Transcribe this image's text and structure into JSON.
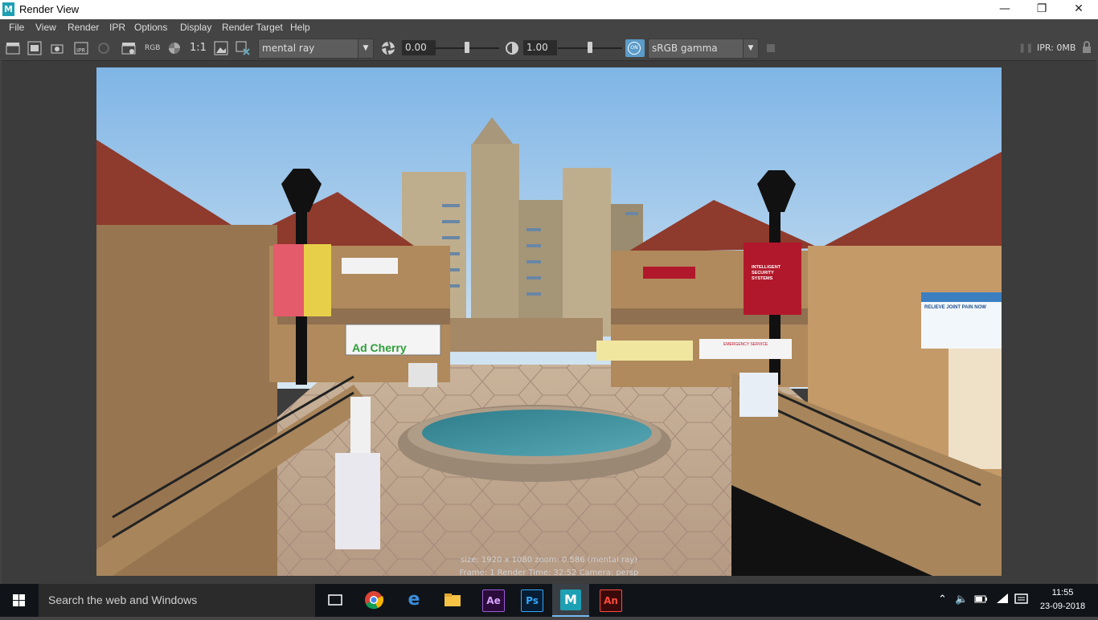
{
  "window": {
    "title": "Render View",
    "app_icon_letter": "M",
    "minimize_icon": "minimize-icon",
    "restore_icon": "restore-icon",
    "close_icon": "close-icon"
  },
  "menu": [
    "File",
    "View",
    "Render",
    "IPR",
    "Options",
    "Display",
    "Render Target",
    "Help"
  ],
  "toolbar": {
    "rgb_label": "RGB",
    "ratio_label": "1:1",
    "renderer": "mental ray",
    "exposure_value": "0.00",
    "exposure_level": 0.5,
    "gamma_value": "1.00",
    "gamma_level": 0.5,
    "colorspace_toggle_label": "ON",
    "colorspace": "sRGB gamma",
    "ipr_memory": "IPR: 0MB"
  },
  "render_info": {
    "line1": "size: 1920 x 1080 zoom: 0.586          (mental ray)",
    "line2": "Frame: 1          Render Time: 32:52          Camera: persp"
  },
  "scene": {
    "sign_cherry": "Ad Cherry",
    "sign_security_1": "INTELLIGENT",
    "sign_security_2": "SECURITY",
    "sign_security_3": "SYSTEMS",
    "sign_joint": "RELIEVE JOINT PAIN NOW",
    "sign_emergency": "EMERGENCY SERVICE",
    "sky_top": "#7fb5e6",
    "sky_bottom": "#d7e7f2",
    "roof_color": "#8e3a2c",
    "wall_color": "#b08a5c"
  },
  "taskbar": {
    "search_placeholder": "Search the web and Windows",
    "apps": [
      "Task View",
      "Chrome",
      "Edge",
      "File Explorer",
      "Ae",
      "Ps",
      "Maya",
      "An"
    ],
    "app_ae": "Ae",
    "app_ps": "Ps",
    "app_maya": "M",
    "app_an": "An",
    "time": "11:55",
    "date": "23-09-2018"
  }
}
